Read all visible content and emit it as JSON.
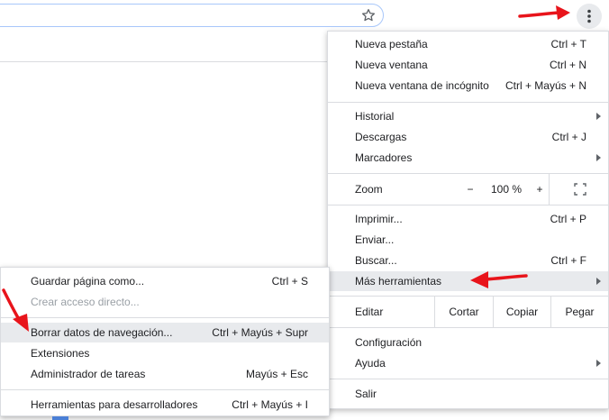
{
  "menu": {
    "items_group1": [
      {
        "label": "Nueva pestaña",
        "shortcut": "Ctrl + T"
      },
      {
        "label": "Nueva ventana",
        "shortcut": "Ctrl + N"
      },
      {
        "label": "Nueva ventana de incógnito",
        "shortcut": "Ctrl + Mayús + N"
      }
    ],
    "items_group2": [
      {
        "label": "Historial",
        "shortcut": ""
      },
      {
        "label": "Descargas",
        "shortcut": "Ctrl + J"
      },
      {
        "label": "Marcadores",
        "shortcut": ""
      }
    ],
    "zoom": {
      "label": "Zoom",
      "minus": "−",
      "value": "100 %",
      "plus": "+"
    },
    "items_group3": [
      {
        "label": "Imprimir...",
        "shortcut": "Ctrl + P"
      },
      {
        "label": "Enviar...",
        "shortcut": ""
      },
      {
        "label": "Buscar...",
        "shortcut": "Ctrl + F"
      },
      {
        "label": "Más herramientas",
        "shortcut": ""
      }
    ],
    "edit": {
      "label": "Editar",
      "cut": "Cortar",
      "copy": "Copiar",
      "paste": "Pegar"
    },
    "items_group4": [
      {
        "label": "Configuración",
        "shortcut": ""
      },
      {
        "label": "Ayuda",
        "shortcut": ""
      }
    ],
    "exit": {
      "label": "Salir"
    }
  },
  "submenu": {
    "items": [
      {
        "label": "Guardar página como...",
        "shortcut": "Ctrl + S"
      },
      {
        "label": "Crear acceso directo...",
        "shortcut": ""
      },
      {
        "label": "Borrar datos de navegación...",
        "shortcut": "Ctrl + Mayús + Supr"
      },
      {
        "label": "Extensiones",
        "shortcut": ""
      },
      {
        "label": "Administrador de tareas",
        "shortcut": "Mayús + Esc"
      },
      {
        "label": "Herramientas para desarrolladores",
        "shortcut": "Ctrl + Mayús + I"
      }
    ]
  },
  "colors": {
    "arrow": "#e8141b",
    "highlight": "#e8eaed",
    "disabled": "#9aa0a6"
  }
}
